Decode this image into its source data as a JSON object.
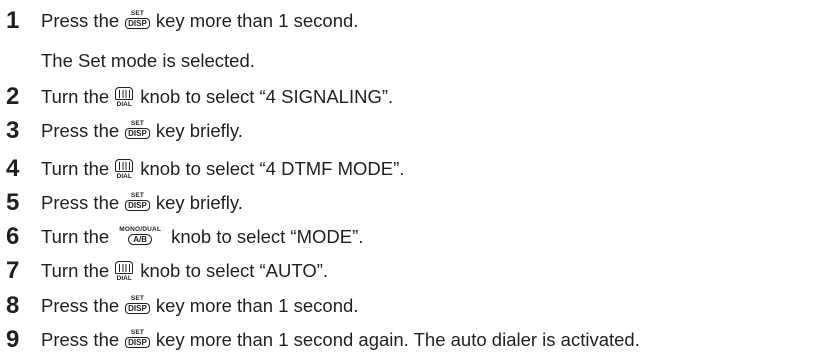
{
  "icons": {
    "set_disp": {
      "top": "SET",
      "box": "DISP"
    },
    "dial": {
      "label": "DIAL"
    },
    "mono_dual": {
      "top": "MONO/DUAL",
      "box": "A/B"
    }
  },
  "steps": [
    {
      "num": "1",
      "pre": "Press the",
      "post": "key more than 1 second.",
      "note": "The Set mode is selected."
    },
    {
      "num": "2",
      "pre": "Turn the",
      "post": "knob to select “4 SIGNALING”."
    },
    {
      "num": "3",
      "pre": "Press the",
      "post": "key briefly."
    },
    {
      "num": "4",
      "pre": "Turn the",
      "post": "knob to select “4 DTMF MODE”."
    },
    {
      "num": "5",
      "pre": "Press the",
      "post": "key briefly."
    },
    {
      "num": "6",
      "pre": "Turn the",
      "post": "knob to select “MODE”."
    },
    {
      "num": "7",
      "pre": "Turn the",
      "post": "knob to select “AUTO”."
    },
    {
      "num": "8",
      "pre": "Press the",
      "post": "key more than 1 second."
    },
    {
      "num": "9",
      "pre": "Press the",
      "post": "key more than 1 second again. The auto dialer is activated."
    }
  ]
}
